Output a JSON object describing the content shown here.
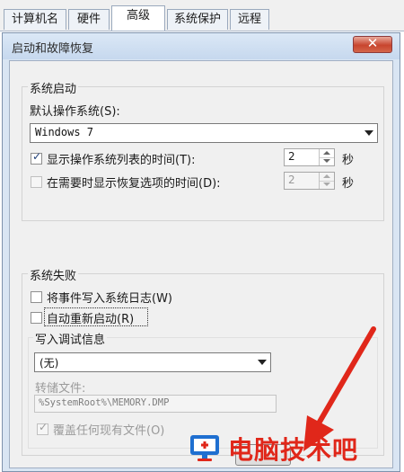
{
  "tabs": [
    "计算机名",
    "硬件",
    "高级",
    "系统保护",
    "远程"
  ],
  "dialog": {
    "title": "启动和故障恢复",
    "close_glyph": "✕"
  },
  "startup": {
    "group_label": "系统启动",
    "default_os_label": "默认操作系统(S):",
    "default_os_value": "Windows 7",
    "show_list_label": "显示操作系统列表的时间(T):",
    "show_list_checked": true,
    "show_list_value": "2",
    "show_list_unit": "秒",
    "show_recovery_label": "在需要时显示恢复选项的时间(D):",
    "show_recovery_checked": false,
    "show_recovery_value": "2",
    "show_recovery_unit": "秒"
  },
  "failure": {
    "group_label": "系统失败",
    "write_event_label": "将事件写入系统日志(W)",
    "write_event_checked": false,
    "auto_restart_label": "自动重新启动(R)",
    "auto_restart_checked": false,
    "debug_group_label": "写入调试信息",
    "debug_value": "(无)",
    "dump_file_label": "转储文件:",
    "dump_file_value": "%SystemRoot%\\MEMORY.DMP",
    "overwrite_label": "覆盖任何现有文件(O)",
    "overwrite_checked": true
  },
  "watermark": {
    "text": "电脑技术吧"
  },
  "colors": {
    "accent_red": "#e0271a",
    "dialog_blue": "#d9e5f3"
  }
}
